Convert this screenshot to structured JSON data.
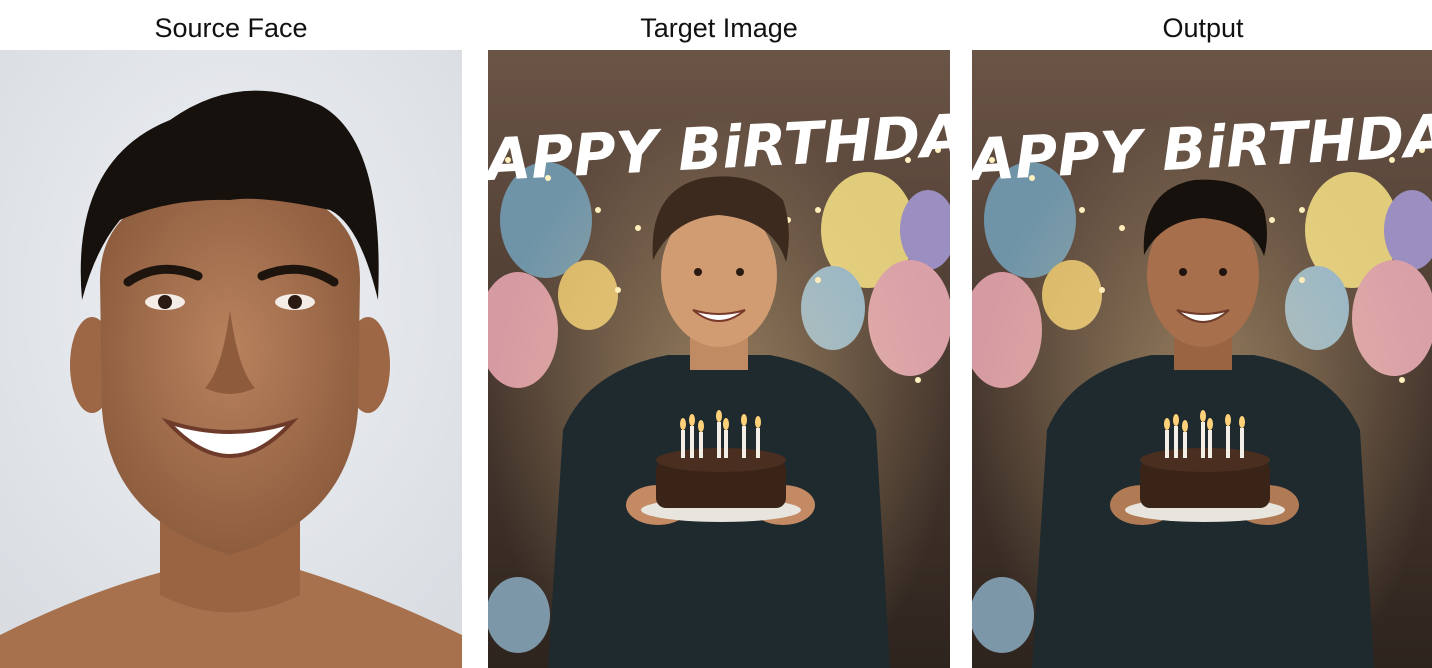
{
  "panels": [
    {
      "caption": "Source Face",
      "image": "portrait of smiling man, light grey background"
    },
    {
      "caption": "Target Image",
      "image": "young man holding chocolate birthday cake with candles, balloons and string lights"
    },
    {
      "caption": "Output",
      "image": "face-swapped birthday scene"
    }
  ],
  "banner_text": "HAPPY BiRTHDAY",
  "colors": {
    "background": "#ffffff",
    "caption_text": "#111111",
    "studio_bg": "#e3e6ea",
    "party_bg": "#4a3a30",
    "sweater": "#1f2a2e",
    "cake": "#3a2418"
  }
}
